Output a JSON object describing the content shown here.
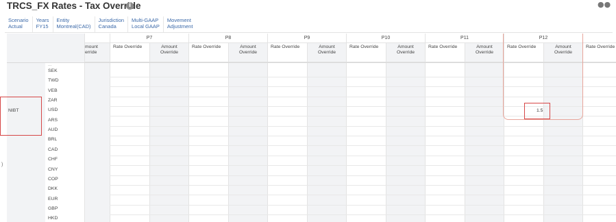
{
  "header": {
    "title": "TRCS_FX Rates - Tax Override",
    "info_icon": "info-icon",
    "corner_icon": "users-icon"
  },
  "pov": [
    {
      "label": "Scenario",
      "value": "Actual"
    },
    {
      "label": "Years",
      "value": "FY15"
    },
    {
      "label": "Entity",
      "value": "Montreal(CAD)"
    },
    {
      "label": "Jurisdiction",
      "value": "Canada"
    },
    {
      "label": "Multi-GAAP",
      "value": "Local GAAP"
    },
    {
      "label": "Movement",
      "value": "Adjustment"
    }
  ],
  "grid": {
    "row_header": "NIBT",
    "periods": [
      "P7",
      "P8",
      "P9",
      "P10",
      "P11",
      "P12"
    ],
    "partial_left": {
      "line1": "mount",
      "line2": "erride"
    },
    "rate_label": "Rate Override",
    "amount_label_line1": "Amount",
    "amount_label_line2": "Override",
    "trailing_rate_label": "Rate Override",
    "partial_top_row": "...",
    "currencies": [
      "SEK",
      "TWD",
      "VEB",
      "ZAR",
      "USD",
      "ARS",
      "AUD",
      "BRL",
      "CAD",
      "CHF",
      "CNY",
      "COP",
      "DKK",
      "EUR",
      "GBP",
      "HKD"
    ],
    "value_p12_usd": "1.5",
    "left_marker": ")"
  },
  "colors": {
    "link_blue": "#3a68a8",
    "shaded": "#f2f3f5",
    "highlight_red": "#d64545",
    "highlight_pink": "#e8a59a"
  }
}
